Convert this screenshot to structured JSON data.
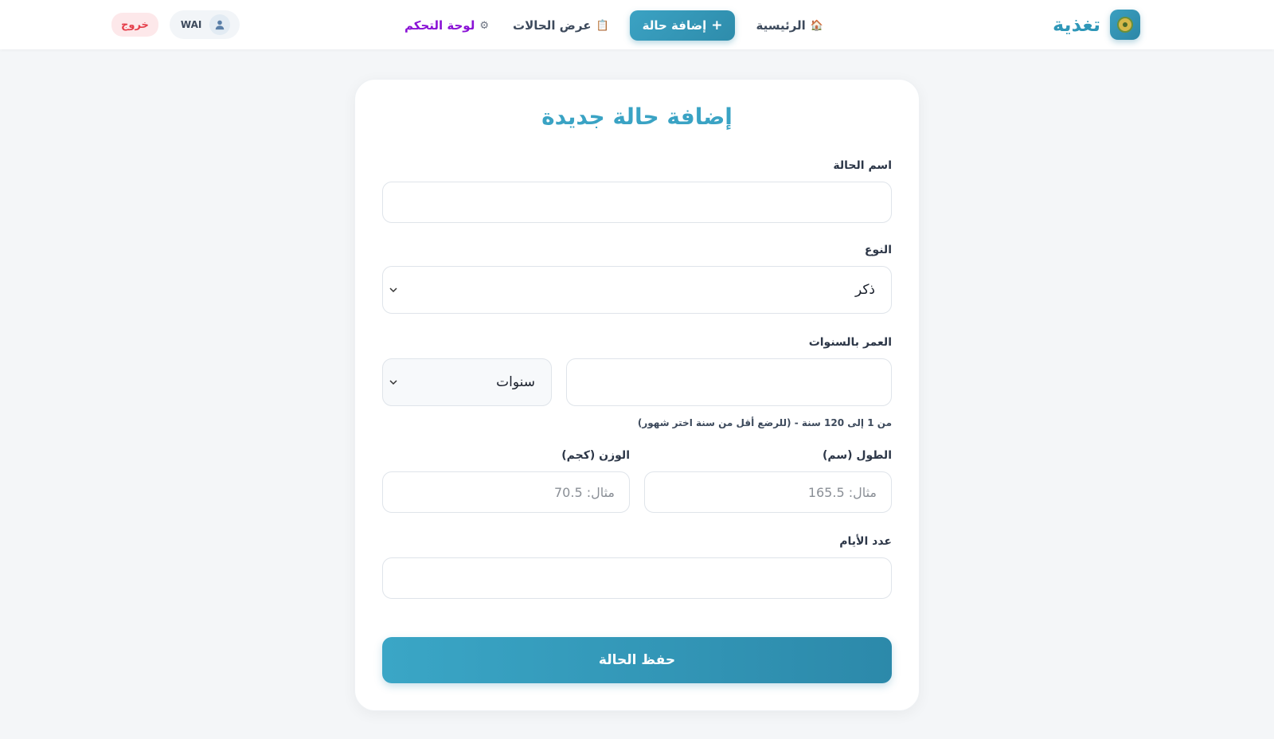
{
  "header": {
    "brand_name": "تغذية",
    "nav": [
      {
        "label": "الرئيسية",
        "icon": "🏠"
      },
      {
        "label": "إضافة حالة",
        "icon": "+"
      },
      {
        "label": "عرض الحالات",
        "icon": "📋"
      },
      {
        "label": "لوحة التحكم",
        "icon": "⚙"
      }
    ],
    "username": "WAI",
    "logout_label": "خروج"
  },
  "form": {
    "title": "إضافة حالة جديدة",
    "name_label": "اسم الحالة",
    "name_value": "",
    "gender_label": "النوع",
    "gender_value": "ذكر",
    "age_label": "العمر بالسنوات",
    "age_value": "",
    "age_unit_value": "سنوات",
    "age_hint": "من 1 إلى 120 سنة - (للرضع أقل من سنة اختر شهور)",
    "height_label": "الطول (سم)",
    "height_placeholder": "مثال: 165.5",
    "weight_label": "الوزن (كجم)",
    "weight_placeholder": "مثال: 70.5",
    "days_label": "عدد الأيام",
    "days_value": "",
    "submit_label": "حفظ الحالة"
  },
  "colors": {
    "primary": "#2f97b8",
    "admin_link": "#8a12d6",
    "logout": "#e53e4a",
    "background": "#f4f6f8"
  }
}
